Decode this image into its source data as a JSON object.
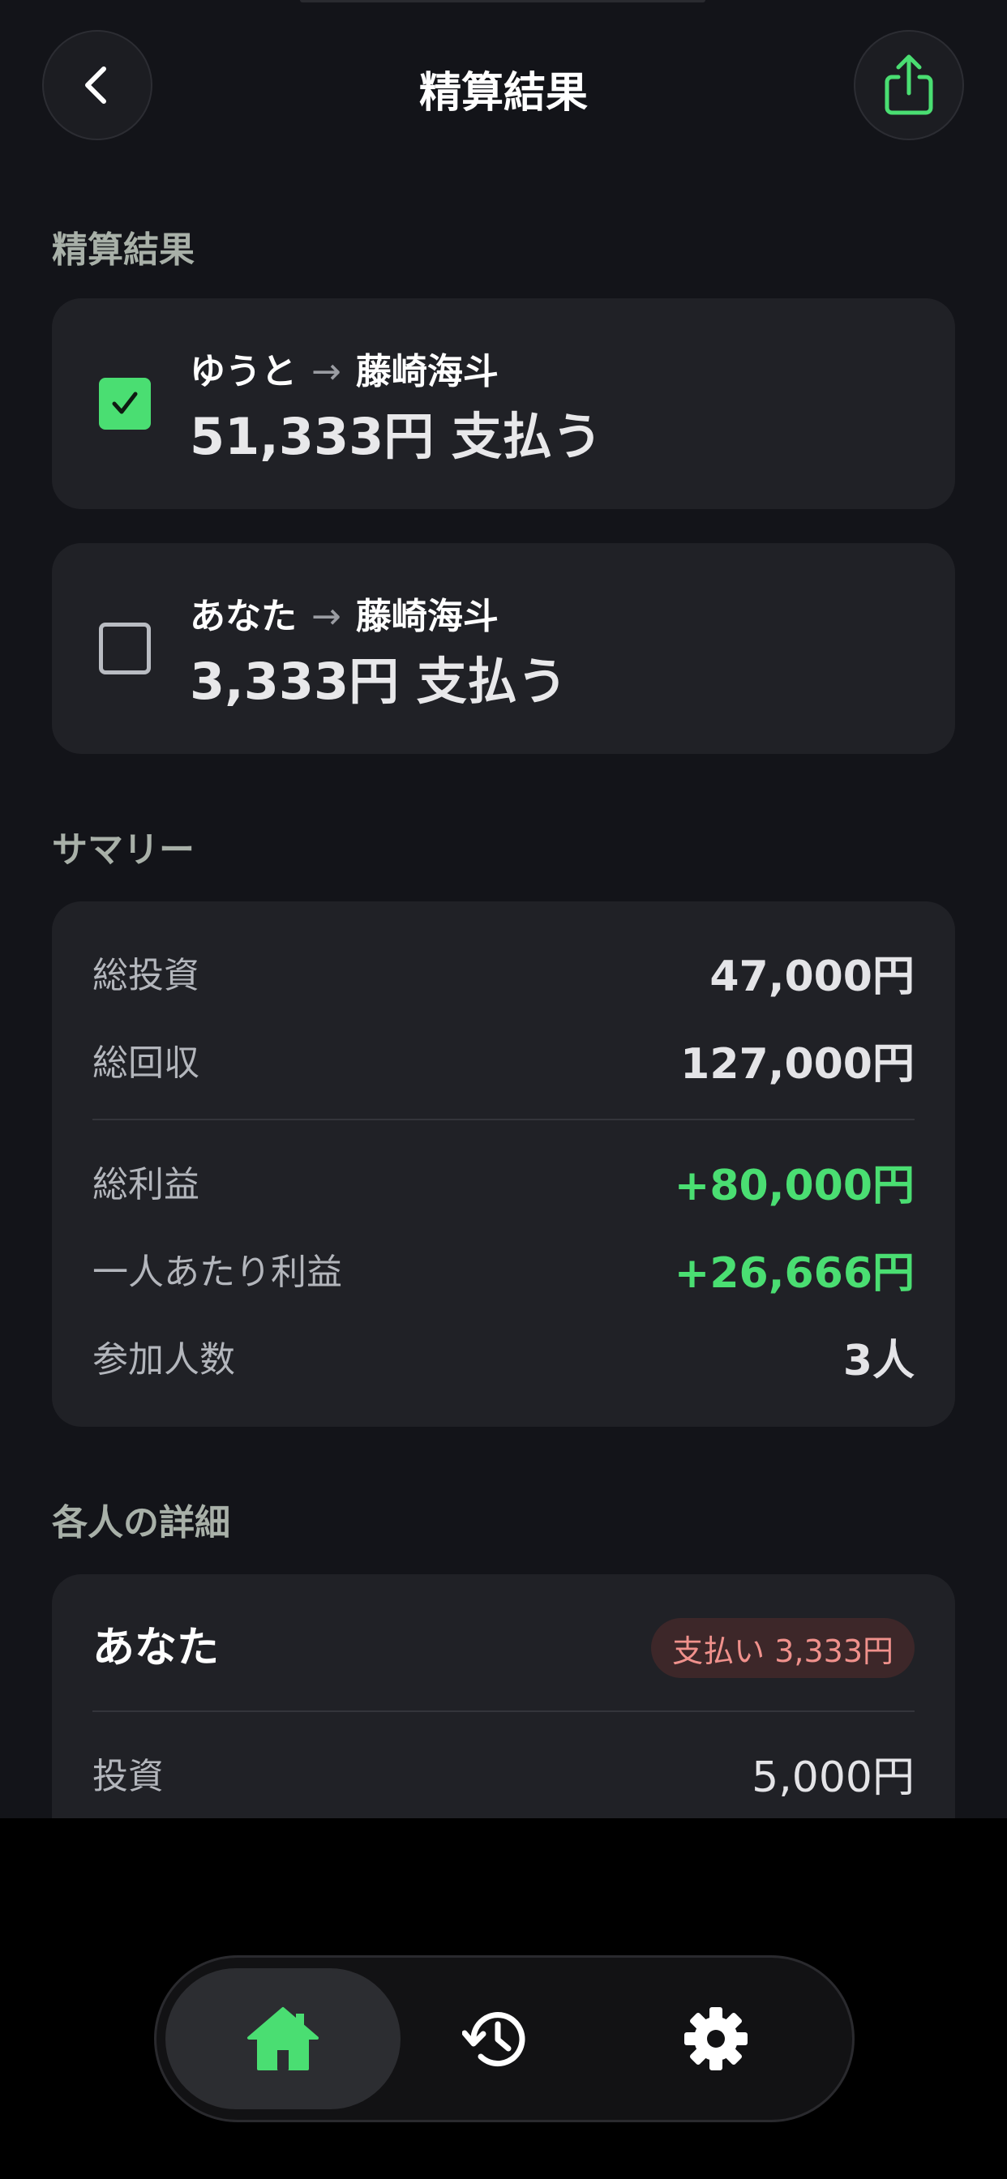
{
  "header": {
    "title": "精算結果"
  },
  "settlement": {
    "section_title": "精算結果",
    "payments": [
      {
        "from": "ゆうと",
        "arrow": "→",
        "to": "藤崎海斗",
        "amount_text": "51,333円 支払う",
        "checked": true
      },
      {
        "from": "あなた",
        "arrow": "→",
        "to": "藤崎海斗",
        "amount_text": "3,333円 支払う",
        "checked": false
      }
    ]
  },
  "summary": {
    "section_title": "サマリー",
    "rows": [
      {
        "label": "総投資",
        "value": "47,000円"
      },
      {
        "label": "総回収",
        "value": "127,000円"
      },
      {
        "label": "総利益",
        "value": "+80,000円"
      },
      {
        "label": "一人あたり利益",
        "value": "+26,666円"
      },
      {
        "label": "参加人数",
        "value": "3人"
      }
    ]
  },
  "details": {
    "section_title": "各人の詳細",
    "people": [
      {
        "name": "あなた",
        "badge": "支払い 3,333円",
        "rows": [
          {
            "label": "投資",
            "value": "5,000円"
          }
        ]
      }
    ]
  },
  "tabbar": {
    "tabs": [
      {
        "icon": "home-icon",
        "active": true
      },
      {
        "icon": "history-icon",
        "active": false
      },
      {
        "icon": "gear-icon",
        "active": false
      }
    ]
  },
  "colors": {
    "background": "#131419",
    "card": "#202126",
    "accent_green": "#4ade72",
    "badge_bg": "#3d2729",
    "badge_text": "#f0918c"
  }
}
